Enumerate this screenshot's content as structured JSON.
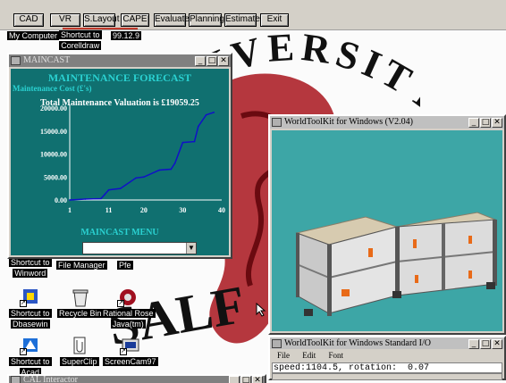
{
  "toolbar": {
    "buttons": [
      "CAD",
      "VR",
      "S.Layout",
      "CAPE",
      "Evaluate",
      "Planning",
      "Estimate",
      "Exit"
    ]
  },
  "wallpaper": {
    "arc_text": "UNIVERSITY",
    "bottom_text": "SALF"
  },
  "desktop_icons": {
    "my_computer": "My Computer",
    "corel": [
      "Shortcut to",
      "Corelldraw"
    ],
    "top_right": "99.12.9",
    "winword": [
      "Shortcut to",
      "Winword"
    ],
    "file_manager": "File Manager",
    "pfe": "Pfe",
    "dbasewin": [
      "Shortcut to",
      "Dbasewin"
    ],
    "recycle": "Recycle Bin",
    "rose": [
      "Rational Rose",
      "Java(tm)"
    ],
    "acad": [
      "Shortcut to",
      "Acad"
    ],
    "superclip": "SuperClip",
    "screencam": "ScreenCam97",
    "bottom_window": "CAL Interactor"
  },
  "maincast": {
    "window_title": "MAINCAST",
    "title": "MAINTENANCE FORECAST",
    "cost_label": "Maintenance Cost (£'s)",
    "total": "Total Maintenance Valuation is £19059.25",
    "menu_label": "MAINCAST MENU",
    "menu_value": "",
    "colors": {
      "background": "#107070",
      "heading": "#2ad1d1",
      "line": "#1010c8"
    }
  },
  "chart_data": {
    "type": "line",
    "title": "MAINTENANCE FORECAST",
    "ylabel": "Maintenance Cost (£'s)",
    "xlabel": "",
    "xlim": [
      1,
      40
    ],
    "ylim": [
      0,
      20000
    ],
    "xticks": [
      "1",
      "11",
      "20",
      "30",
      "40"
    ],
    "yticks": [
      "0.00",
      "5000.00",
      "10000.00",
      "15000.00",
      "20000.00"
    ],
    "x": [
      1,
      5,
      9,
      10,
      11,
      14,
      18,
      20,
      24,
      27,
      28,
      30,
      33,
      34,
      36,
      38
    ],
    "values": [
      0,
      200,
      300,
      1200,
      2200,
      2500,
      4800,
      5000,
      6500,
      6700,
      8000,
      12500,
      12700,
      16000,
      18500,
      19059.25
    ]
  },
  "wtk": {
    "window_title": "WorldToolKit for Windows (V2.04)",
    "colors": {
      "background": "#3da6a6"
    }
  },
  "wtk_io": {
    "window_title": "WorldToolKit for Windows Standard I/O",
    "menu": [
      "File",
      "Edit",
      "Font"
    ],
    "output": "speed:1104.5, rotation:  0.07"
  },
  "window_buttons": {
    "minimize": "_",
    "maximize": "□",
    "close": "✕"
  }
}
